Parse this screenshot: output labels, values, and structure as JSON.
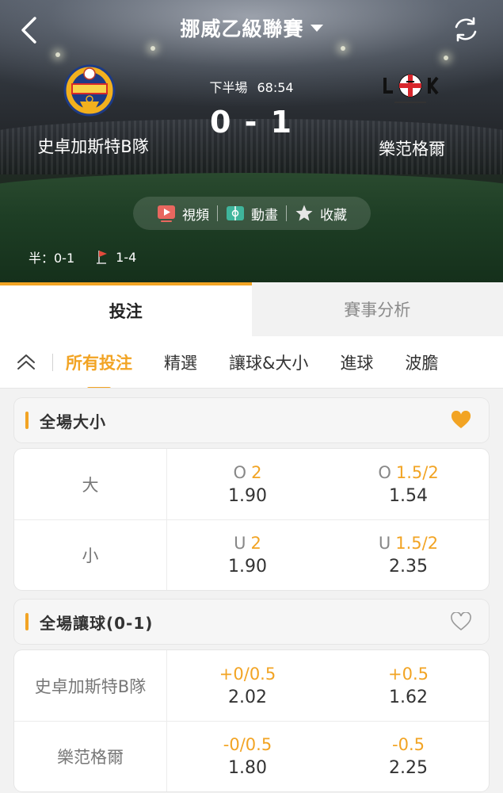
{
  "header": {
    "league": "挪威乙級聯賽"
  },
  "match": {
    "period": "下半場",
    "clock": "68:54",
    "score": "0 - 1",
    "home": {
      "name": "史卓加斯特B隊"
    },
    "away": {
      "name": "樂范格爾"
    },
    "half_score": "半：0-1",
    "corners": "1-4"
  },
  "actions": {
    "video": "視頻",
    "animation": "動畫",
    "favorite": "收藏"
  },
  "main_tabs": [
    {
      "label": "投注"
    },
    {
      "label": "賽事分析"
    }
  ],
  "sub_tabs": [
    {
      "label": "所有投注"
    },
    {
      "label": "精選"
    },
    {
      "label": "讓球&大小"
    },
    {
      "label": "進球"
    },
    {
      "label": "波膽"
    }
  ],
  "markets": [
    {
      "title": "全場大小",
      "favorited": true,
      "rows": [
        {
          "label": "大",
          "cells": [
            {
              "prefix": "O",
              "line": "2",
              "price": "1.90"
            },
            {
              "prefix": "O",
              "line": "1.5/2",
              "price": "1.54"
            }
          ]
        },
        {
          "label": "小",
          "cells": [
            {
              "prefix": "U",
              "line": "2",
              "price": "1.90"
            },
            {
              "prefix": "U",
              "line": "1.5/2",
              "price": "2.35"
            }
          ]
        }
      ]
    },
    {
      "title": "全場讓球(0-1)",
      "favorited": false,
      "rows": [
        {
          "label": "史卓加斯特B隊",
          "cells": [
            {
              "prefix": "",
              "line": "+0/0.5",
              "price": "2.02"
            },
            {
              "prefix": "",
              "line": "+0.5",
              "price": "1.62"
            }
          ]
        },
        {
          "label": "樂范格爾",
          "cells": [
            {
              "prefix": "",
              "line": "-0/0.5",
              "price": "1.80"
            },
            {
              "prefix": "",
              "line": "-0.5",
              "price": "2.25"
            }
          ]
        }
      ]
    }
  ],
  "colors": {
    "accent": "#f2a424",
    "video_icon": "#e8675f",
    "animation_icon": "#3fb59c"
  }
}
